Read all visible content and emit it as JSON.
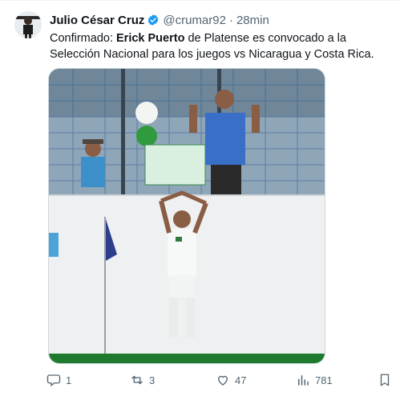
{
  "tweet": {
    "author_name": "Julio César Cruz",
    "handle": "@crumar92",
    "separator": "·",
    "time": "28min",
    "text_prefix": "Confirmado: ",
    "text_bold": "Erick Puerto",
    "text_suffix": " de Platense es convocado a la Selección Nacional para los juegos vs Nicaragua y Costa Rica."
  },
  "actions": {
    "replies": "1",
    "retweets": "3",
    "likes": "47",
    "views": "781"
  },
  "colors": {
    "verified": "#1d9bf0",
    "muted": "#536471",
    "pitch_green": "#1e7a2f",
    "wall": "#eef0f1",
    "fence": "#2c5c92"
  },
  "icons": [
    "verified-badge-icon",
    "reply-icon",
    "retweet-icon",
    "like-icon",
    "views-icon",
    "bookmark-icon"
  ]
}
